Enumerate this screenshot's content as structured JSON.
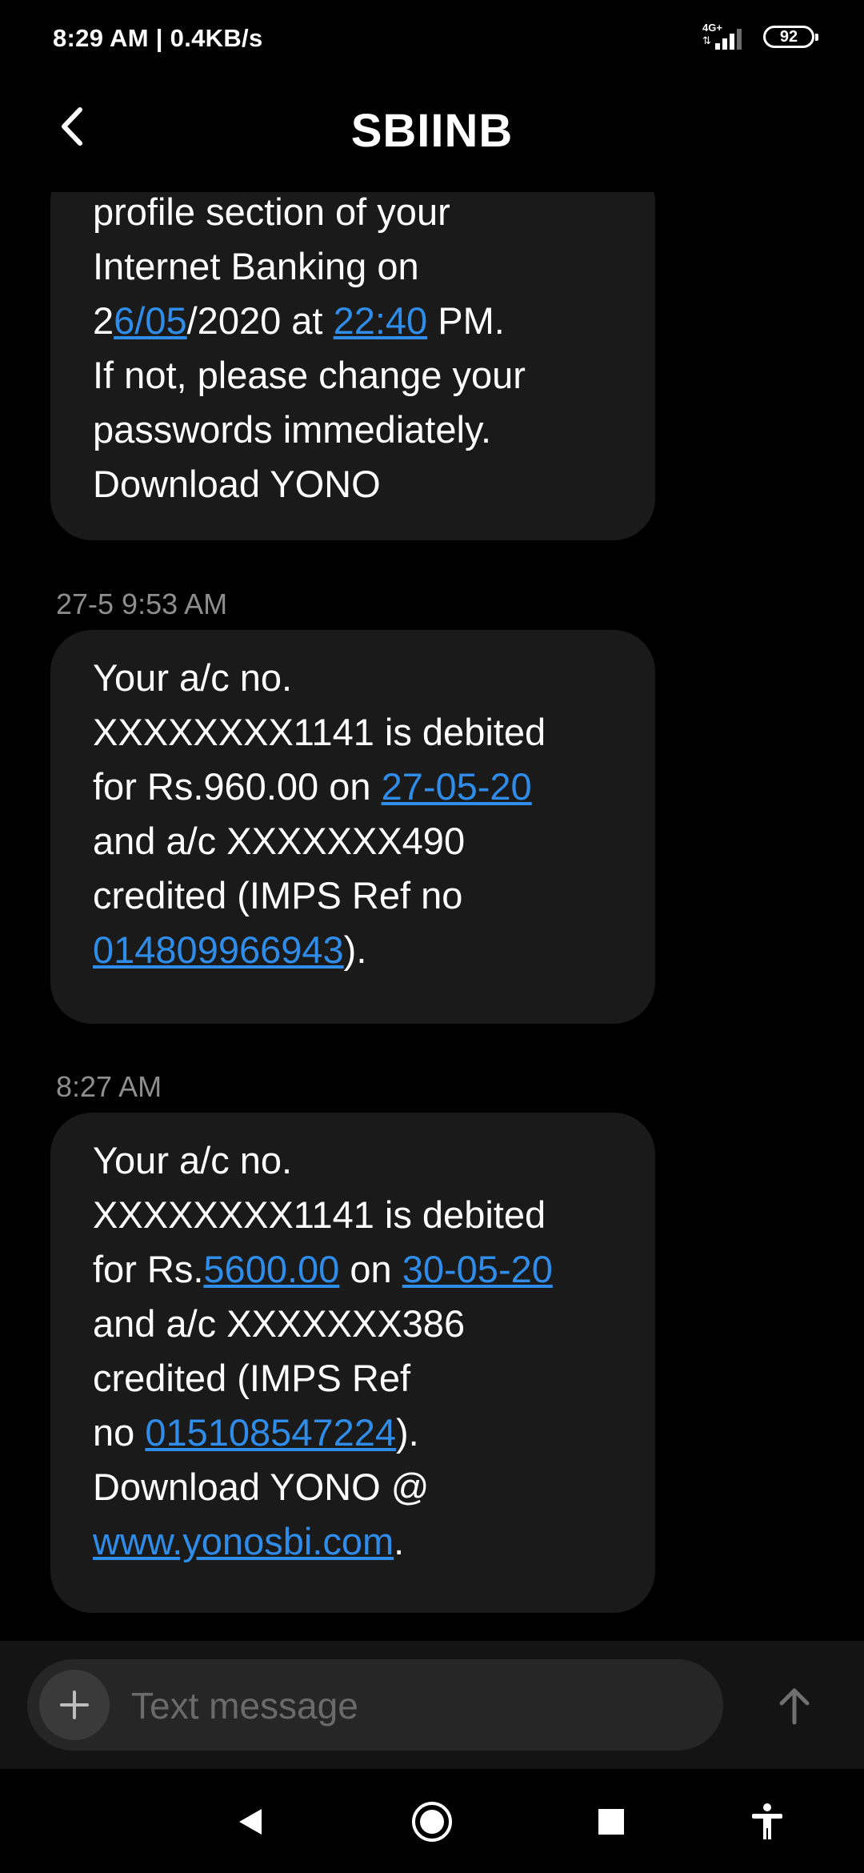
{
  "status_bar": {
    "time": "8:29 AM",
    "separator": "|",
    "speed": "0.4KB/s",
    "network": "4G+",
    "battery": "92"
  },
  "header": {
    "title": "SBIINB"
  },
  "messages": [
    {
      "lines": [
        [
          {
            "t": "profile section of your"
          }
        ],
        [
          {
            "t": "Internet Banking on"
          }
        ],
        [
          {
            "t": "2"
          },
          {
            "t": "6/05",
            "link": true
          },
          {
            "t": "/2020 at "
          },
          {
            "t": "22:40",
            "link": true
          },
          {
            "t": " PM."
          }
        ],
        [
          {
            "t": "If not, please change your"
          }
        ],
        [
          {
            "t": "passwords immediately."
          }
        ],
        [
          {
            "t": "Download YONO"
          }
        ]
      ]
    },
    {
      "timestamp": "27-5 9:53 AM",
      "lines": [
        [
          {
            "t": "Your a/c no."
          }
        ],
        [
          {
            "t": "XXXXXXXX1141 is debited"
          }
        ],
        [
          {
            "t": "for Rs.960.00 on "
          },
          {
            "t": "27-05-20",
            "link": true
          }
        ],
        [
          {
            "t": "and a/c XXXXXXX490"
          }
        ],
        [
          {
            "t": "credited (IMPS Ref no"
          }
        ],
        [
          {
            "t": "014809966943",
            "link": true
          },
          {
            "t": ")."
          }
        ]
      ]
    },
    {
      "timestamp": "8:27 AM",
      "lines": [
        [
          {
            "t": "Your a/c no."
          }
        ],
        [
          {
            "t": "XXXXXXXX1141 is debited"
          }
        ],
        [
          {
            "t": "for Rs."
          },
          {
            "t": "5600.00",
            "link": true
          },
          {
            "t": " on "
          },
          {
            "t": "30-05-20",
            "link": true
          }
        ],
        [
          {
            "t": "and a/c XXXXXXX386"
          }
        ],
        [
          {
            "t": "credited (IMPS Ref"
          }
        ],
        [
          {
            "t": "no "
          },
          {
            "t": "015108547224",
            "link": true
          },
          {
            "t": ")."
          }
        ],
        [
          {
            "t": "Download YONO @"
          }
        ],
        [
          {
            "t": "www.yonosbi.com",
            "link": true
          },
          {
            "t": "."
          }
        ]
      ]
    }
  ],
  "composer": {
    "placeholder": "Text message"
  },
  "icons": {
    "back": "back-arrow-icon",
    "add": "plus-icon",
    "send": "arrow-up-icon",
    "nav_back": "triangle-back-icon",
    "nav_home": "circle-home-icon",
    "nav_recents": "square-recents-icon",
    "nav_accessibility": "accessibility-icon"
  },
  "colors": {
    "background": "#000000",
    "bubble": "#1a1a1a",
    "link": "#2f8ce9",
    "timestamp": "#8e8e8e",
    "composer_bar": "#141414",
    "composer": "#262626"
  }
}
